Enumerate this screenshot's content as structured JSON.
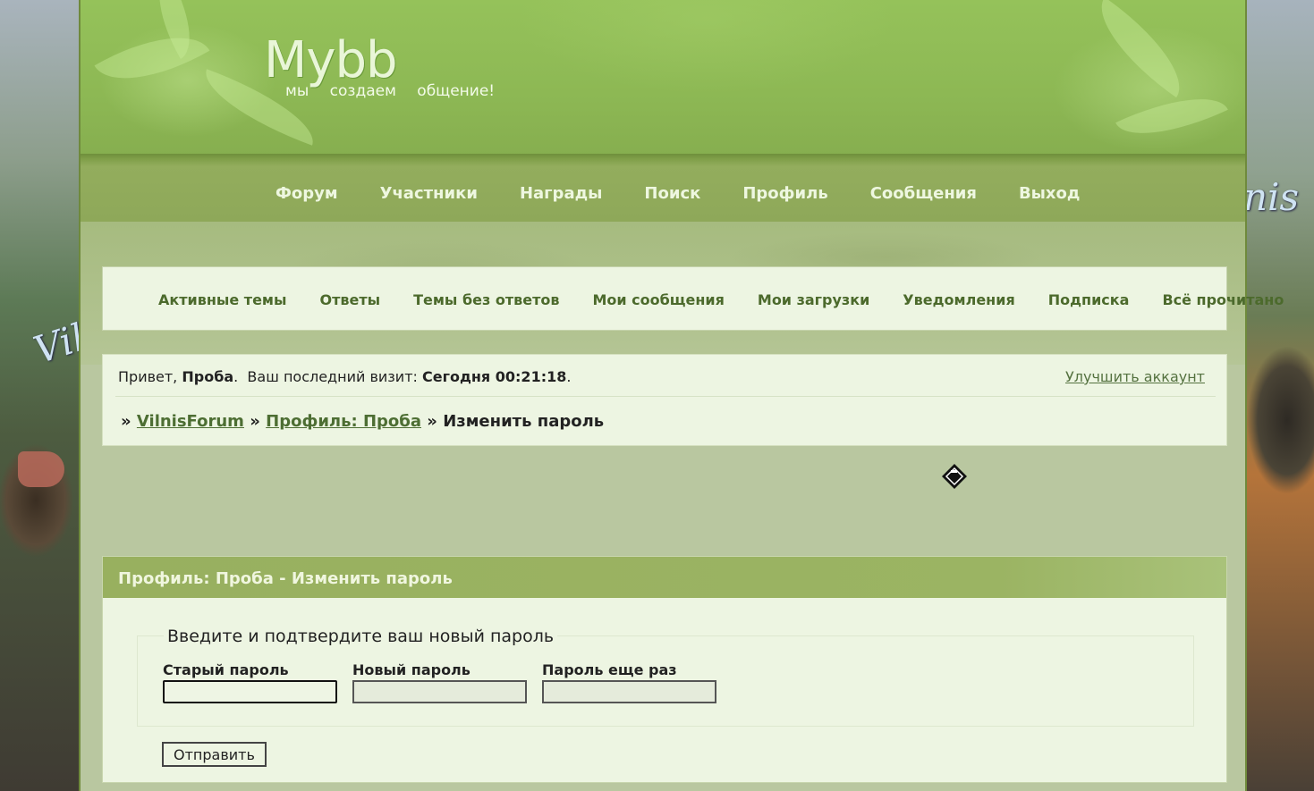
{
  "background": {
    "left_text": "Vil",
    "right_text": "nis"
  },
  "header": {
    "logo": "Mybb",
    "tagline": "мы создаем общение!"
  },
  "main_nav": {
    "items": [
      "Форум",
      "Участники",
      "Награды",
      "Поиск",
      "Профиль",
      "Сообщения",
      "Выход"
    ]
  },
  "sub_nav": {
    "items": [
      "Активные темы",
      "Ответы",
      "Темы без ответов",
      "Мои сообщения",
      "Мои загрузки",
      "Уведомления",
      "Подписка",
      "Всё прочитано"
    ]
  },
  "welcome": {
    "greeting": "Привет, ",
    "username": "Проба",
    "last_visit_label": ".  Ваш последний визит: ",
    "last_visit_value": "Сегодня 00:21:18",
    "end": ".",
    "upgrade_link": "Улучшить аккаунт"
  },
  "breadcrumb": {
    "sep": "» ",
    "forum": "VilnisForum",
    "profile": "Профиль: Проба",
    "current": "Изменить пароль"
  },
  "form": {
    "title": "Профиль: Проба - Изменить пароль",
    "legend": "Введите и подтвердите ваш новый пароль",
    "old_password_label": "Старый пароль",
    "old_password_value": "",
    "new_password_label": "Новый пароль",
    "new_password_value": "",
    "repeat_password_label": "Пароль еще раз",
    "repeat_password_value": "",
    "submit_label": "Отправить"
  },
  "colors": {
    "header_green": "#8db854",
    "nav_green": "#93ad5d",
    "panel_bg": "#edf5e2",
    "link_green": "#4d6e33"
  }
}
